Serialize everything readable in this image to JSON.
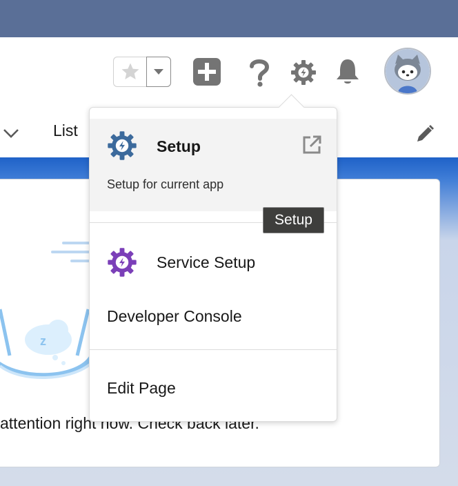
{
  "nav": {
    "list_label": "List"
  },
  "content": {
    "empty_message": "attention right now. Check back later."
  },
  "menu": {
    "setup": {
      "title": "Setup",
      "subtitle": "Setup for current app"
    },
    "service_setup": {
      "label": "Service Setup"
    },
    "developer_console": {
      "label": "Developer Console"
    },
    "edit_page": {
      "label": "Edit Page"
    }
  },
  "tooltip": {
    "text": "Setup"
  },
  "icons": {
    "favorites": "star-icon",
    "favorites_menu": "chevron-down-icon",
    "add": "plus-icon",
    "help": "question-icon",
    "setup": "gear-icon",
    "notifications": "bell-icon",
    "external": "external-link-icon"
  },
  "colors": {
    "header_band": "#5a6f97",
    "brand_blue": "#1f62c8",
    "setup_gear": "#3c6a9c",
    "service_gear": "#7b3fb8",
    "tooltip_bg": "#3e3e3c"
  }
}
